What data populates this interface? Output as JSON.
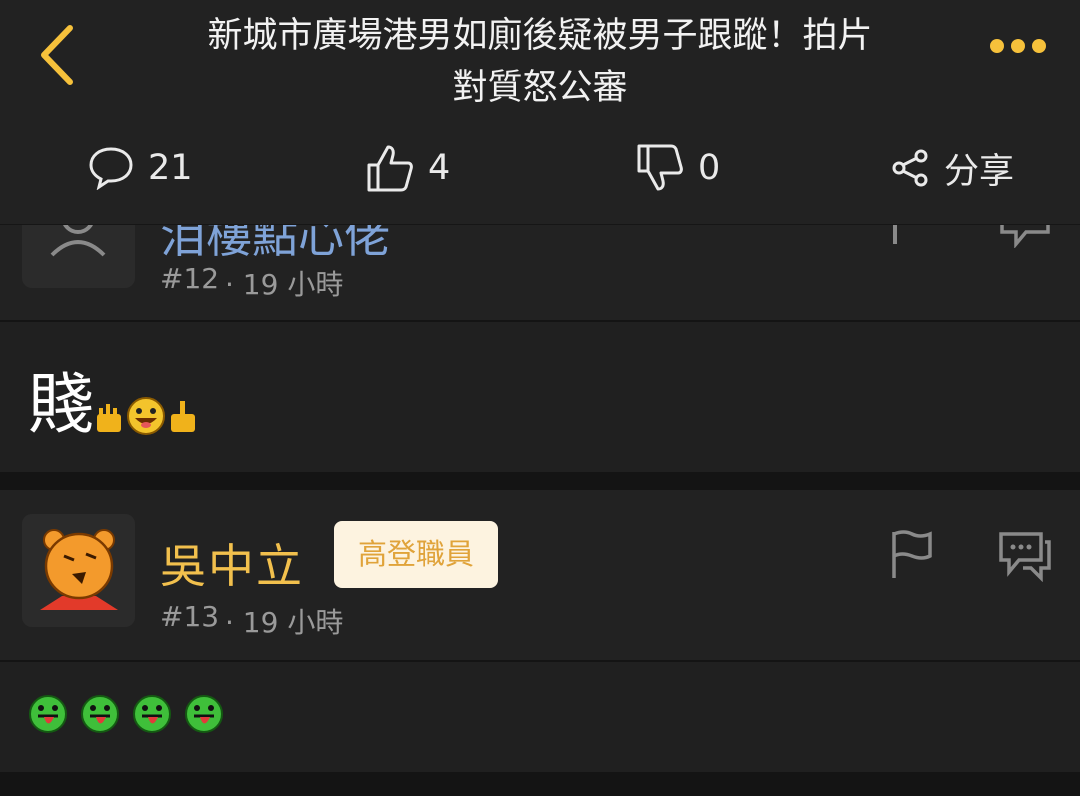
{
  "header": {
    "title_line1": "新城市廣場港男如廁後疑被男子跟蹤！拍片",
    "title_line2": "對質怒公審",
    "comments": "21",
    "likes": "4",
    "dislikes": "0",
    "share_label": "分享"
  },
  "posts": [
    {
      "username_partial": "泪樓點心佬",
      "number": "#12",
      "time": "· 19 小時",
      "body_text": "賤"
    },
    {
      "username": "吳中立",
      "badge": "高登職員",
      "number": "#13",
      "time": "· 19 小時"
    }
  ],
  "colors": {
    "accent": "#f6c13b",
    "username": "#f2c04d",
    "username_blue": "#7fa3d8",
    "background": "#1c1c1c",
    "badge_bg": "#fdf3e0",
    "badge_text": "#e0a33a"
  },
  "icons": [
    "back-chevron-icon",
    "more-dots-icon",
    "comment-icon",
    "thumb-up-icon",
    "thumb-down-icon",
    "share-icon",
    "user-placeholder-icon",
    "flag-icon",
    "reply-chat-icon",
    "bear-avatar",
    "hand-emoji",
    "grin-emoji",
    "tongue-emoji"
  ]
}
